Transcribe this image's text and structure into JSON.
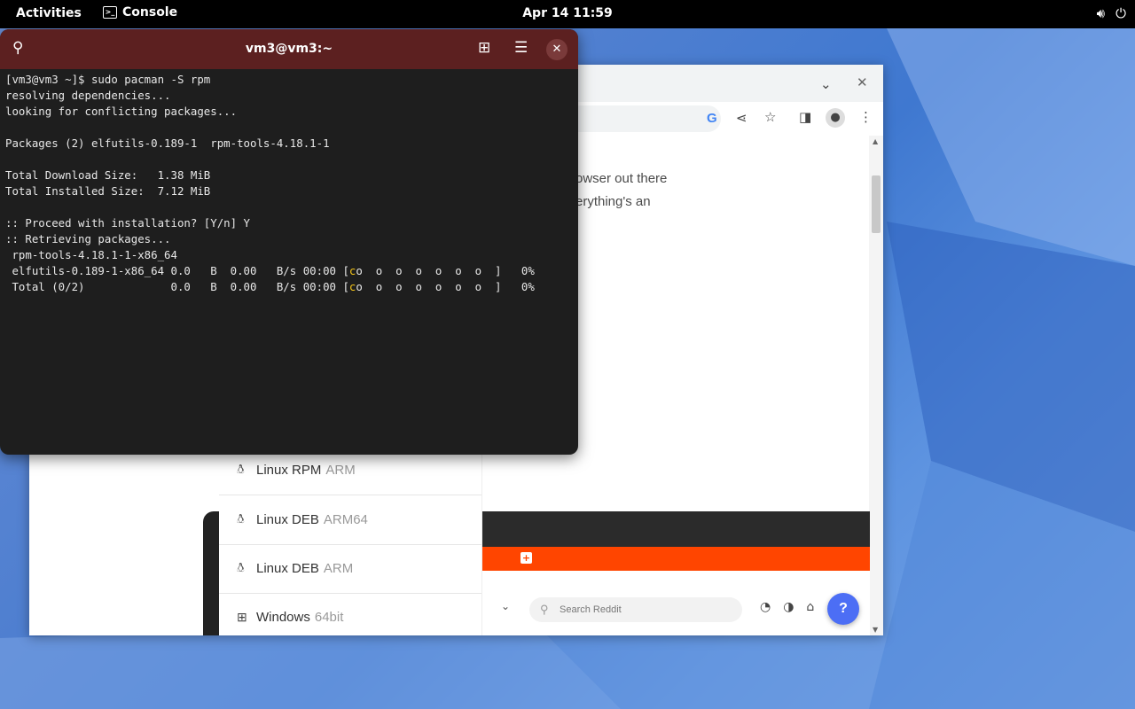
{
  "topbar": {
    "activities": "Activities",
    "app_name": "Console",
    "app_icon": "terminal-icon",
    "clock": "Apr 14  11:59",
    "volume_icon": "volume-icon",
    "power_icon": "power-icon"
  },
  "terminal": {
    "title": "vm3@vm3:~",
    "icons": {
      "search": "search-icon",
      "new_tab": "new-tab-icon",
      "menu": "hamburger-menu-icon",
      "close": "close-icon"
    },
    "lines": [
      "[vm3@vm3 ~]$ sudo pacman -S rpm",
      "resolving dependencies...",
      "looking for conflicting packages...",
      "",
      "Packages (2) elfutils-0.189-1  rpm-tools-4.18.1-1",
      "",
      "Total Download Size:   1.38 MiB",
      "Total Installed Size:  7.12 MiB",
      "",
      ":: Proceed with installation? [Y/n] Y",
      ":: Retrieving packages...",
      " rpm-tools-4.18.1-1-x86_64"
    ],
    "progress_rows": [
      {
        "prefix": " elfutils-0.189-1-x86_64 0.0   B  0.00   B/s 00:00 [",
        "pacman": "c",
        "dots": "o  o  o  o  o  o  o  ]",
        "percent": "   0%"
      },
      {
        "prefix": " Total (0/2)             0.0   B  0.00   B/s 00:00 [",
        "pacman": "c",
        "dots": "o  o  o  o  o  o  o  ]",
        "percent": "   0%"
      }
    ]
  },
  "browser": {
    "tab_dropdown_icon": "chevron-down-icon",
    "tab_close_icon": "close-icon",
    "toolbar_icons": [
      "google-icon",
      "share-icon",
      "star-icon",
      "sidebar-icon",
      "profile-icon",
      "more-vert-icon"
    ],
    "page_text": [
      "owser out there",
      "erything's an"
    ],
    "downloads": [
      {
        "os": "Linux RPM",
        "arch": "ARM",
        "icon": "linux-icon"
      },
      {
        "os": "Linux DEB",
        "arch": "ARM64",
        "icon": "linux-icon"
      },
      {
        "os": "Linux DEB",
        "arch": "ARM",
        "icon": "linux-icon"
      },
      {
        "os": "Windows",
        "arch": "64bit",
        "icon": "windows-icon"
      }
    ],
    "screenshot_search_placeholder": "Search Reddit",
    "help_button": "?"
  }
}
